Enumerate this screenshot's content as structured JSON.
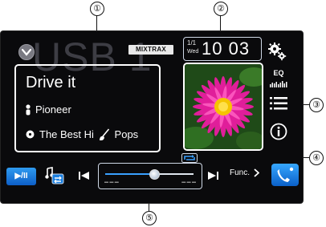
{
  "callouts": [
    "①",
    "②",
    "③",
    "④",
    "⑤"
  ],
  "source": {
    "watermark": "USB 1"
  },
  "header": {
    "mixtrax_label": "MIXTRAX",
    "date": "1/1",
    "day": "Wed",
    "time": "10 03"
  },
  "track": {
    "title": "Drive it",
    "artist": "Pioneer",
    "album": "The Best Hi",
    "genre": "Pops"
  },
  "right_menu": {
    "eq_label": "EQ"
  },
  "transport": {
    "play_pause_label": "▶/II",
    "func_label": "Func.",
    "seek_progress": 0.55
  },
  "icons": [
    "source-menu-icon",
    "settings-icon",
    "eq-icon",
    "list-icon",
    "info-icon",
    "artist-icon",
    "album-icon",
    "genre-icon",
    "repeat-icon",
    "mode-icon",
    "previous-track-icon",
    "next-track-icon",
    "phone-icon"
  ],
  "colors": {
    "screen_bg": "#0a0a0c",
    "accent_blue": "#1a7fe0",
    "frame": "#ffffff",
    "seek_fill": "#3aa0ff"
  }
}
